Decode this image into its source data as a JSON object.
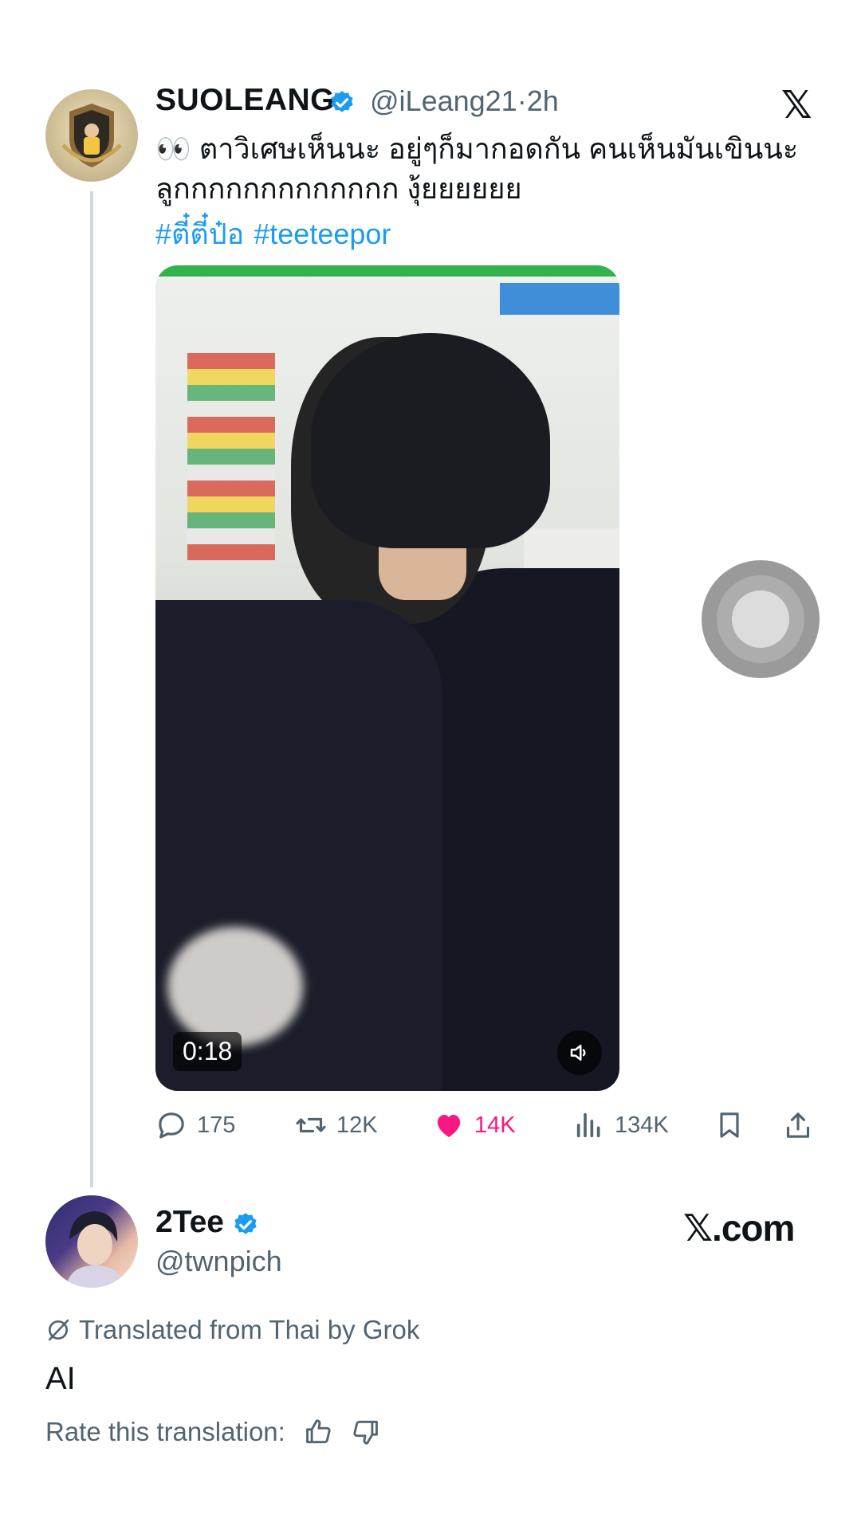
{
  "tweet": {
    "author_name": "SUOLEANG",
    "author_handle": "@iLeang21",
    "separator": "·",
    "time": "2h",
    "text": "👀 ตาวิเศษเห็นนะ อยู่ๆก็มากอดกัน คนเห็นมันเขินนะลูกกกกกกกกกกกกก งุ้ยยยยยย",
    "hashtags": [
      "#ตี๋ตี๋ป๋อ",
      "#teeteepor"
    ],
    "video": {
      "duration": "0:18"
    },
    "stats": {
      "replies": "175",
      "reposts": "12K",
      "likes": "14K",
      "views": "134K"
    }
  },
  "reply_author": {
    "name": "2Tee",
    "handle": "@twnpich"
  },
  "brand": "𝕏.com",
  "translation": {
    "label": "Translated from Thai by Grok",
    "text": "AI",
    "rate_label": "Rate this translation:"
  },
  "colors": {
    "verified": "#1d9bf0",
    "link": "#1d9bf0",
    "like": "#f91880",
    "muted": "#536471"
  },
  "icons": {
    "close": "x-logo-icon",
    "reply": "reply-icon",
    "repost": "repost-icon",
    "like": "heart-icon",
    "views": "views-icon",
    "bookmark": "bookmark-icon",
    "share": "share-icon",
    "mute": "speaker-icon",
    "translate": "translate-icon",
    "thumbs_up": "thumbs-up-icon",
    "thumbs_down": "thumbs-down-icon"
  }
}
